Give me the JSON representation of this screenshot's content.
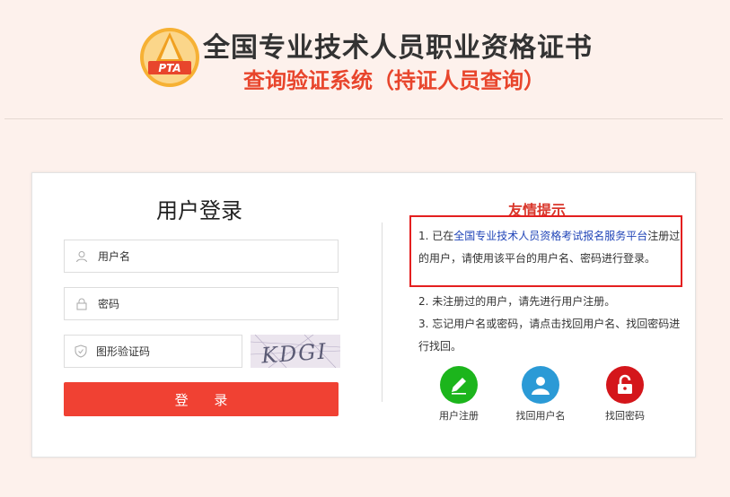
{
  "header": {
    "logo_text": "PTA",
    "title": "全国专业技术人员职业资格证书",
    "subtitle": "查询验证系统（持证人员查询）"
  },
  "login": {
    "title": "用户登录",
    "username_placeholder": "用户名",
    "password_placeholder": "密码",
    "captcha_placeholder": "图形验证码",
    "captcha_text": "KDGI",
    "submit_label": "登 录"
  },
  "tips": {
    "title": "友情提示",
    "tip1_prefix": "1. 已在",
    "tip1_link": "全国专业技术人员资格考试报名服务平台",
    "tip1_suffix": "注册过的用户，请使用该平台的用户名、密码进行登录。",
    "tip2": "2. 未注册过的用户，请先进行用户注册。",
    "tip3": "3. 忘记用户名或密码，请点击找回用户名、找回密码进行找回。"
  },
  "actions": {
    "register": {
      "label": "用户注册",
      "color": "#1cb51c",
      "icon": "pencil-icon"
    },
    "find_username": {
      "label": "找回用户名",
      "color": "#2b9ad6",
      "icon": "user-icon"
    },
    "find_password": {
      "label": "找回密码",
      "color": "#d4161b",
      "icon": "lock-icon"
    }
  },
  "colors": {
    "page_bg": "#fdf1ec",
    "accent_red": "#f04133",
    "link_blue": "#2246b8"
  }
}
